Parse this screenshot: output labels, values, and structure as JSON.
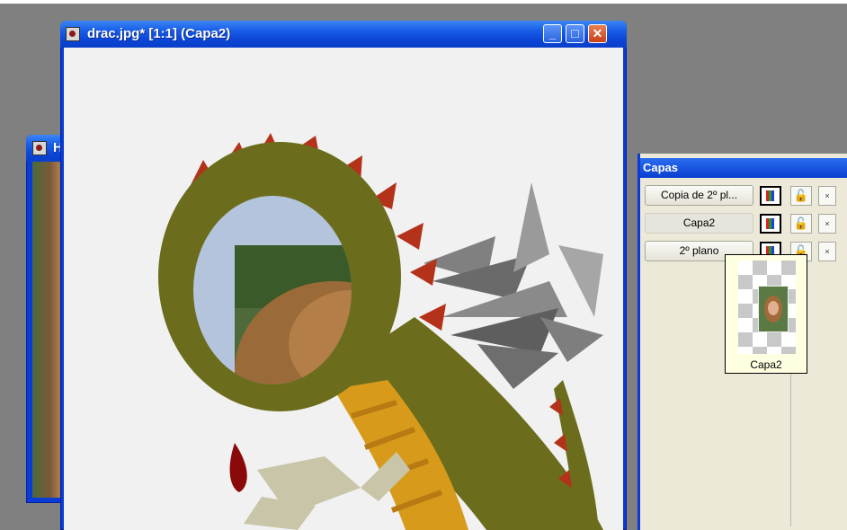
{
  "background_window": {
    "title_fragment": "H"
  },
  "main_window": {
    "title": "drac.jpg* [1:1] (Capa2)",
    "buttons": {
      "minimize": "_",
      "maximize": "□",
      "close": "✕"
    },
    "icon": "image-icon"
  },
  "layers_panel": {
    "title": "Capas",
    "layers": [
      {
        "name": "Copia de 2º pl...",
        "visible_icon": "visibility-icon",
        "lock_icon": "unlock-icon",
        "delete_glyph": "×"
      },
      {
        "name": "Capa2",
        "visible_icon": "visibility-icon",
        "lock_icon": "unlock-icon",
        "delete_glyph": "×"
      },
      {
        "name": "2º plano",
        "visible_icon": "visibility-icon",
        "lock_icon": "unlock-icon",
        "delete_glyph": "×"
      }
    ],
    "tooltip": {
      "label": "Capa2"
    }
  },
  "colors": {
    "xp_blue": "#0a3bd6",
    "dragon_green": "#6b6d1c",
    "dragon_red": "#b5321a",
    "dragon_yellow": "#d89a1a",
    "canvas_bg": "#f1f1f1",
    "panel_bg": "#ece9d8"
  }
}
